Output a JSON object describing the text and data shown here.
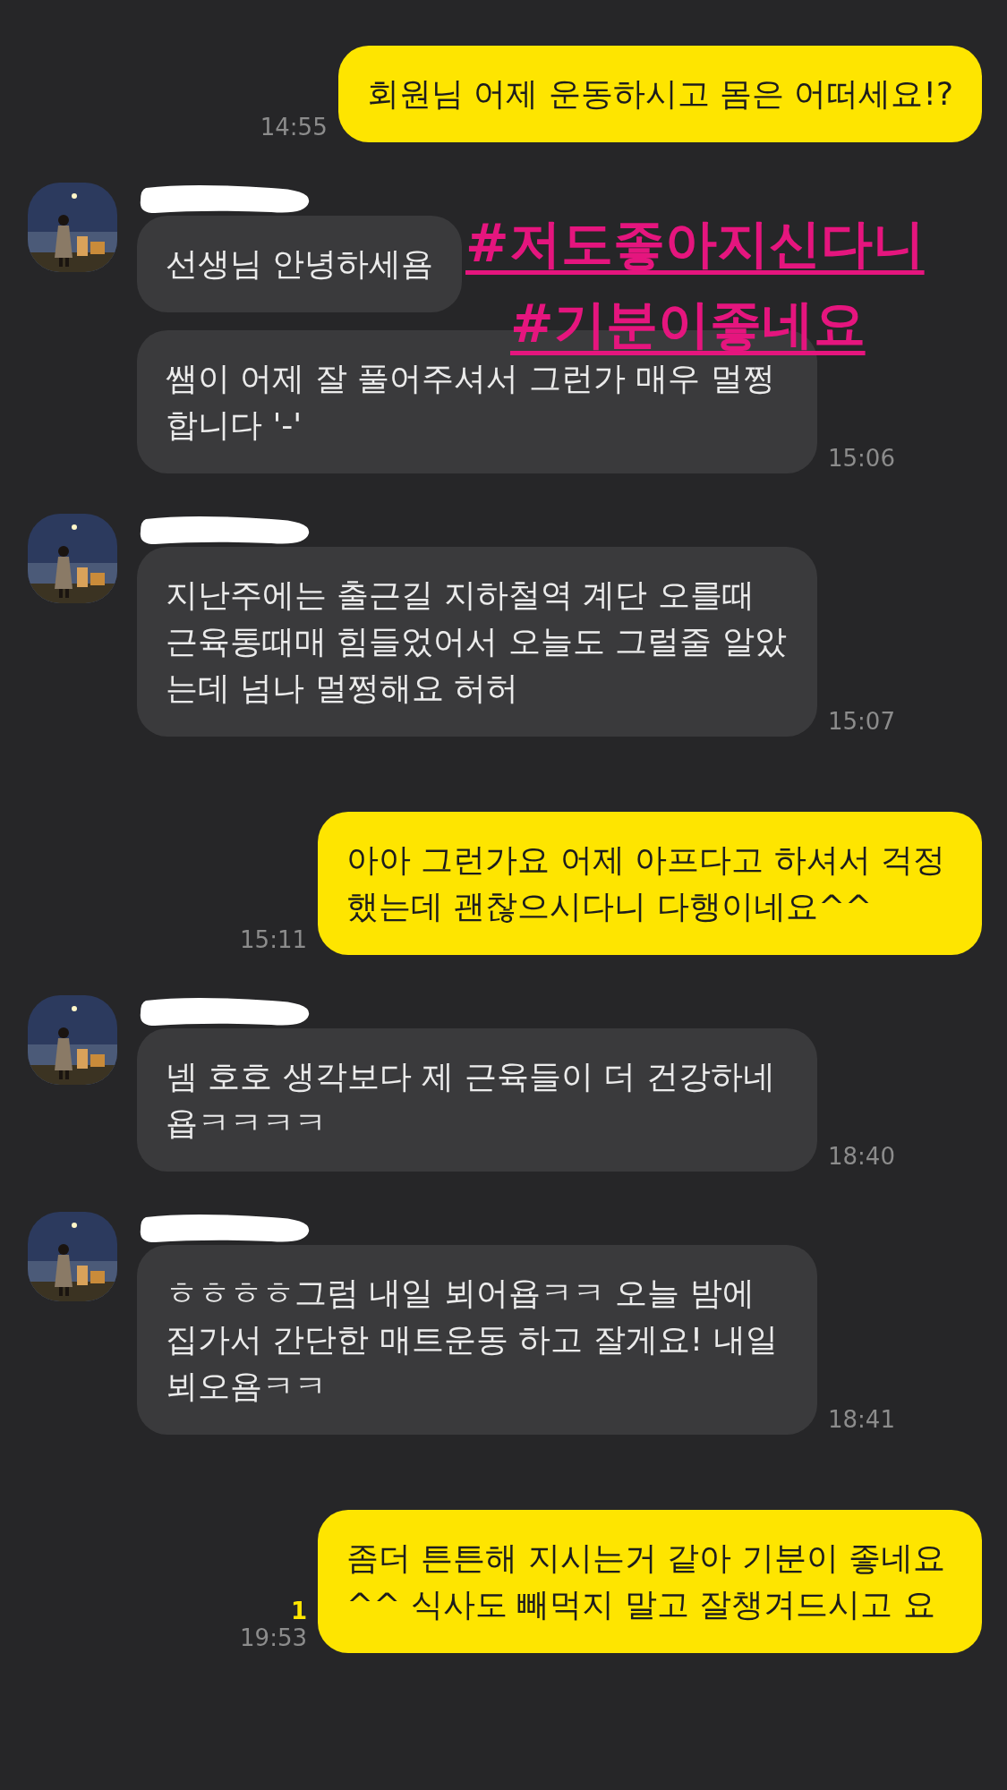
{
  "messages": [
    {
      "kind": "outgoing",
      "bubbles": [
        "회원님 어제 운동하시고 몸은 어떠세요!?"
      ],
      "time": "14:55"
    },
    {
      "kind": "incoming",
      "name_hidden": true,
      "bubbles": [
        "선생님 안녕하세욤",
        "쌤이 어제 잘 풀어주셔서 그런가 매우 멀쩡합니다 '-'"
      ],
      "time": "15:06"
    },
    {
      "kind": "incoming",
      "name_hidden": true,
      "bubbles": [
        "지난주에는 출근길 지하철역 계단 오를때 근육통때매 힘들었어서 오늘도 그럴줄 알았는데 넘나 멀쩡해요 허허"
      ],
      "time": "15:07"
    },
    {
      "kind": "outgoing",
      "bubbles": [
        "아아 그런가요 어제 아프다고 하셔서 걱정했는데 괜찮으시다니 다행이네요^^"
      ],
      "time": "15:11"
    },
    {
      "kind": "incoming",
      "name_hidden": true,
      "bubbles": [
        "넴 호호 생각보다 제 근육들이 더 건강하네욥ㅋㅋㅋㅋ"
      ],
      "time": "18:40"
    },
    {
      "kind": "incoming",
      "name_hidden": true,
      "bubbles": [
        "ㅎㅎㅎㅎ그럼 내일 뵈어욥ㅋㅋ 오늘 밤에 집가서 간단한 매트운동 하고 잘게요! 내일뵈오욤ㅋㅋ"
      ],
      "time": "18:41"
    },
    {
      "kind": "outgoing",
      "bubbles": [
        "좀더 튼튼해 지시는거 같아 기분이 좋네요^^ 식사도 빼먹지 말고 잘챙겨드시고 요"
      ],
      "time": "19:53",
      "unread": "1"
    }
  ],
  "overlay_tags": [
    "#저도좋아지신다니",
    "#기분이좋네요"
  ]
}
